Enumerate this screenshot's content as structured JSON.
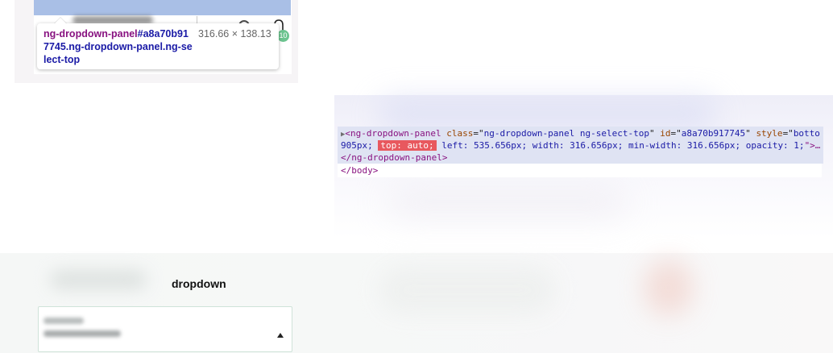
{
  "inspector_tooltip": {
    "tag": "ng-dropdown-panel",
    "selector_rest": "#a8a70b917745.ng-dropdown-panel.ng-select-top",
    "dimensions": "316.66 × 138.13",
    "badge_count": "10"
  },
  "elements_panel": {
    "line1": {
      "open": "<",
      "tag": "ng-dropdown-panel",
      "attr_class": "class",
      "val_class": "ng-dropdown-panel ng-select-top",
      "attr_id": "id",
      "val_id": "a8a70b917745",
      "attr_style": "style",
      "val_style_start": "botto"
    },
    "line2": {
      "style_lead": "905px; ",
      "highlight": "top: auto;",
      "style_rest": " left: 535.656px; width: 316.656px; min-width: 316.656px; opacity: 1;",
      "close": "\">…"
    },
    "line3": "</ng-dropdown-panel>",
    "line4": "</body>"
  },
  "page": {
    "dropdown_label": "dropdown"
  },
  "colors": {
    "tag": "#881280",
    "attr": "#994500",
    "value": "#1a1aa6",
    "highlight": "#e8585e",
    "badge": "#6cc48f",
    "selected_option": "#a9bfe6"
  }
}
